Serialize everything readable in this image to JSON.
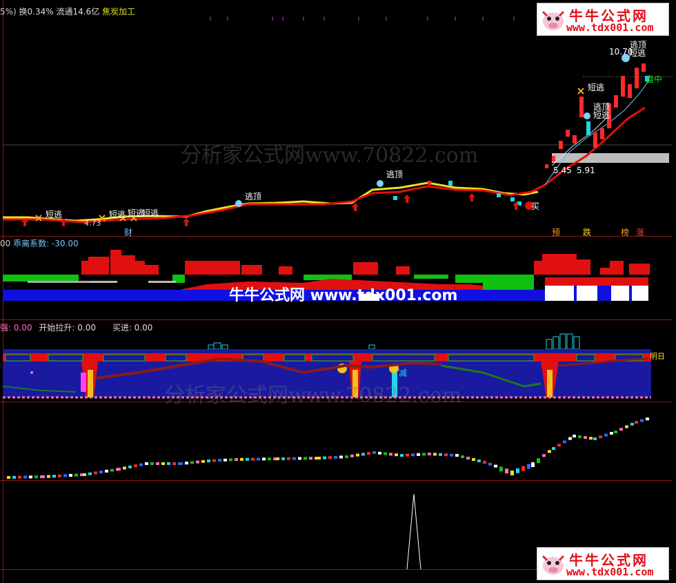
{
  "header": {
    "prefix": "5%)",
    "turnover": "换0.34%",
    "float": "流通14.6亿",
    "sector": "焦炭加工"
  },
  "price_panel": {
    "watermark": "分析家公式网www.70822.com",
    "price_labels": [
      "10.70",
      "5.45",
      "5.91",
      "4.73"
    ],
    "signals": [
      "短逃",
      "短逃",
      "短逃",
      "短逃",
      "短逃",
      "逃顶",
      "逃顶",
      "逃顶",
      "逃顶",
      "短逃",
      "短逃"
    ],
    "bottom_tags": [
      "财",
      "预",
      "跌",
      "榜",
      "涨"
    ],
    "buy_tag": "买",
    "pan_label": "盘中"
  },
  "deviation_panel": {
    "prefix": "00",
    "label": "乖离系数: -30.00",
    "overlay_text": "牛牛公式网 www.tdx001.com"
  },
  "strength_panel": {
    "strong": "强: 0.00",
    "start_rise": "开始拉升: 0.00",
    "buy_in": "买进: 0.00",
    "watermark": "分析家公式网www.70822.com",
    "tomorrow": "明日",
    "reduce": "减"
  },
  "logos": {
    "top": {
      "title": "牛牛公式网",
      "url": "www.tdx001.com"
    },
    "bottom": {
      "title": "牛牛公式网",
      "url": "www.tdx001.com"
    }
  },
  "colors": {
    "up": "#ff2a2a",
    "down": "#21d6e6",
    "ma_yellow": "#f0e020",
    "ma_red": "#e01010",
    "blue_bar": "#1010e0",
    "green_bar": "#10c010",
    "pink": "#ff7ad0"
  }
}
